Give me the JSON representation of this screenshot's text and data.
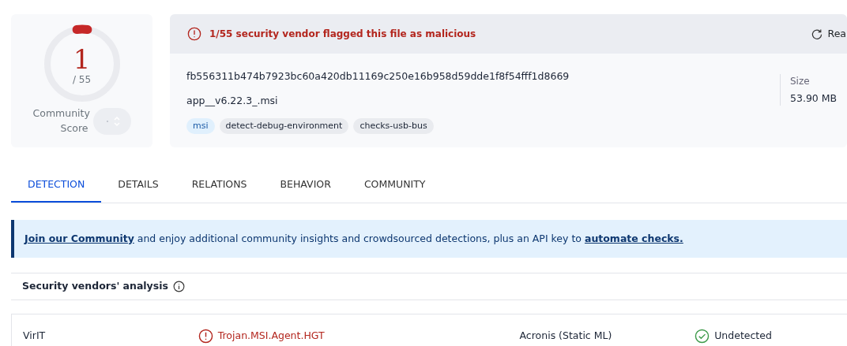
{
  "score": {
    "value": "1",
    "total": "/ 55",
    "label": "Community Score"
  },
  "alert": {
    "text": "1/55 security vendor flagged this file as malicious",
    "action": "Rea"
  },
  "file": {
    "hash": "fb556311b474b7923bc60a420db11169c250e16b958d59dde1f8f54fff1d8669",
    "name": "app__v6.22.3_.msi",
    "tags": [
      {
        "label": "msi",
        "kind": "type"
      },
      {
        "label": "detect-debug-environment",
        "kind": "plain"
      },
      {
        "label": "checks-usb-bus",
        "kind": "plain"
      }
    ],
    "size_label": "Size",
    "size": "53.90 MB"
  },
  "tabs": [
    {
      "label": "DETECTION",
      "selected": true
    },
    {
      "label": "DETAILS",
      "selected": false
    },
    {
      "label": "RELATIONS",
      "selected": false
    },
    {
      "label": "BEHAVIOR",
      "selected": false
    },
    {
      "label": "COMMUNITY",
      "selected": false
    }
  ],
  "banner": {
    "link": "Join our Community",
    "text": " and enjoy additional community insights and crowdsourced detections, plus an API key to ",
    "link2": "automate checks."
  },
  "section_title": "Security vendors' analysis",
  "rows": [
    {
      "cells": [
        {
          "vendor": "VirIT",
          "result": "Trojan.MSI.Agent.HGT",
          "kind": "detected"
        },
        {
          "vendor": "Acronis (Static ML)",
          "result": "Undetected",
          "kind": "undetected"
        }
      ]
    }
  ]
}
